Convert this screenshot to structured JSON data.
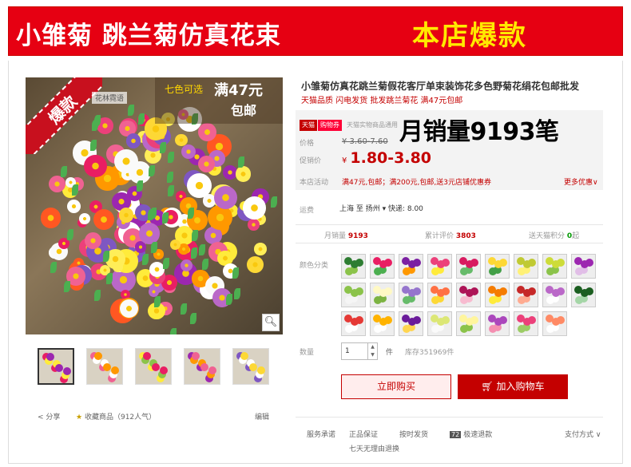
{
  "banner": {
    "title": "小雏菊 跳兰菊仿真花束",
    "tag": "本店爆款"
  },
  "gallery": {
    "hot_badge": "爆款",
    "promo_colors": "七色可选",
    "promo_amount": "满47元",
    "promo_free": "包邮",
    "brand_tag": "花林霓语",
    "thumbnail_count": 5
  },
  "share": {
    "share_label": "分享",
    "favorite_label": "收藏商品",
    "favorite_count": "（912人气）",
    "edit_label": "编辑"
  },
  "product": {
    "title": "小雏菊仿真花跳兰菊假花客厅单束装饰花多色野菊花绢花包邮批发",
    "subtitle": "天猫品质 闪电发货 批发跳兰菊花 满47元包邮"
  },
  "pricebox": {
    "tmall_badge": "天猫",
    "tmall_coupon": "购物券",
    "tmall_text": "天猫实物商品通用",
    "monthly_sales_overlay": "月销量9193笔",
    "price_label": "价格",
    "old_price": "¥ 3.60-7.60",
    "promo_label": "促销价",
    "currency": "¥",
    "promo_price": "1.80-3.80",
    "activity_label": "本店活动",
    "activity_text": "满47元,包邮；满200元,包邮,送3元店铺优惠券",
    "more_offers": "更多优惠"
  },
  "shipping": {
    "label": "运费",
    "text": "上海 至 扬州 ▾ 快递: 8.00"
  },
  "stats": {
    "monthly_label": "月销量",
    "monthly_value": "9193",
    "reviews_label": "累计评价",
    "reviews_value": "3803",
    "points_label": "送天猫积分",
    "points_value": "0",
    "points_unit": "起"
  },
  "options": {
    "color_label": "颜色分类",
    "swatch_colors": [
      [
        "#2e7d32",
        "#8bc34a"
      ],
      [
        "#e91e63",
        "#4caf50"
      ],
      [
        "#7b1fa2",
        "#ff9800"
      ],
      [
        "#ec407a",
        "#ffeb3b"
      ],
      [
        "#d81b60",
        "#66bb6a"
      ],
      [
        "#fdd835",
        "#43a047"
      ],
      [
        "#c0ca33",
        "#fff176"
      ],
      [
        "#cddc39",
        "#8bc34a"
      ],
      [
        "#9c27b0",
        "#e1bee7"
      ],
      [
        "#8bc34a",
        "#f5f5f5"
      ],
      [
        "#fff9c4",
        "#7cb342"
      ],
      [
        "#9575cd",
        "#66bb6a"
      ],
      [
        "#ff7043",
        "#fdd835"
      ],
      [
        "#ad1457",
        "#f8bbd0"
      ],
      [
        "#f57c00",
        "#ffeb3b"
      ],
      [
        "#c62828",
        "#ffab91"
      ],
      [
        "#ba68c8",
        "#ffffff"
      ],
      [
        "#1b5e20",
        "#a5d6a7"
      ],
      [
        "#e53935",
        "#ffffff"
      ],
      [
        "#ffb300",
        "#ffffff"
      ],
      [
        "#6a1b9a",
        "#ffd54f"
      ],
      [
        "#dce775",
        "#fafafa"
      ],
      [
        "#fff59d",
        "#8bc34a"
      ],
      [
        "#ab47bc",
        "#f48fb1"
      ],
      [
        "#ec407a",
        "#9ccc65"
      ],
      [
        "#ff8a65",
        "#ffffff"
      ]
    ],
    "qty_label": "数量",
    "qty_value": "1",
    "qty_unit": "件",
    "stock": "库存351969件"
  },
  "actions": {
    "buy_now": "立即购买",
    "add_cart": "加入购物车"
  },
  "service": {
    "label": "服务承诺",
    "item1": "正品保证",
    "item2": "按时发货",
    "item3_badge": "72",
    "item3": "极速退款",
    "payment": "支付方式",
    "item4": "七天无理由退换"
  }
}
